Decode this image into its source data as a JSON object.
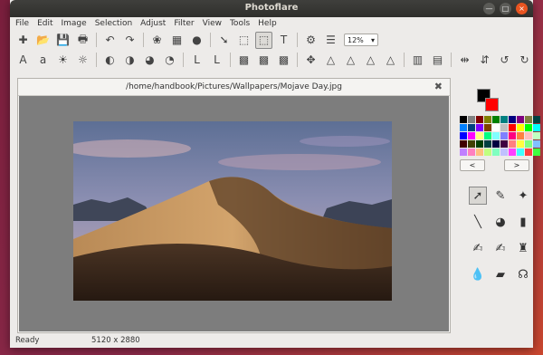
{
  "window": {
    "title": "Photoflare",
    "min": "—",
    "max": "□",
    "close": "×"
  },
  "menu": [
    "File",
    "Edit",
    "Image",
    "Selection",
    "Adjust",
    "Filter",
    "View",
    "Tools",
    "Help"
  ],
  "toolbar1": [
    {
      "name": "new-file-icon",
      "glyph": "✚"
    },
    {
      "name": "open-folder-icon",
      "glyph": "📂"
    },
    {
      "name": "save-icon",
      "glyph": "💾"
    },
    {
      "name": "print-icon",
      "glyph": "🖶"
    },
    {
      "name": "undo-icon",
      "glyph": "↶"
    },
    {
      "name": "redo-icon",
      "glyph": "↷"
    },
    {
      "name": "color-palette-icon",
      "glyph": "❀"
    },
    {
      "name": "mosaic-icon",
      "glyph": "▦"
    },
    {
      "name": "color-balls-icon",
      "glyph": "●"
    },
    {
      "name": "pointer-icon",
      "glyph": "➘"
    },
    {
      "name": "select-icon",
      "glyph": "⬚"
    },
    {
      "name": "select-active-icon",
      "glyph": "⬚"
    },
    {
      "name": "text-icon",
      "glyph": "T"
    },
    {
      "name": "settings-icon",
      "glyph": "⚙"
    },
    {
      "name": "layers-icon",
      "glyph": "☰"
    }
  ],
  "zoom": {
    "value": "12%",
    "arrow": "▾"
  },
  "toolbar2": [
    {
      "name": "text-size-icon",
      "glyph": "A"
    },
    {
      "name": "text-style-icon",
      "glyph": "a"
    },
    {
      "name": "brightness-up-icon",
      "glyph": "☀"
    },
    {
      "name": "brightness-down-icon",
      "glyph": "☼"
    },
    {
      "name": "contrast-icon",
      "glyph": "◐"
    },
    {
      "name": "contrast2-icon",
      "glyph": "◑"
    },
    {
      "name": "saturation-icon",
      "glyph": "◕"
    },
    {
      "name": "red-tone-icon",
      "glyph": "◔"
    },
    {
      "name": "edge-icon",
      "glyph": "L"
    },
    {
      "name": "edge2-icon",
      "glyph": "L"
    },
    {
      "name": "grayscale-icon",
      "glyph": "▩"
    },
    {
      "name": "photo-icon",
      "glyph": "▩"
    },
    {
      "name": "sepia-icon",
      "glyph": "▩"
    },
    {
      "name": "move-icon",
      "glyph": "✥"
    },
    {
      "name": "triangle-icon",
      "glyph": "△"
    },
    {
      "name": "triangle2-icon",
      "glyph": "△"
    },
    {
      "name": "triangle3-icon",
      "glyph": "△"
    },
    {
      "name": "triangle4-icon",
      "glyph": "△"
    },
    {
      "name": "rainbow-icon",
      "glyph": "▥"
    },
    {
      "name": "gradient-icon",
      "glyph": "▤"
    },
    {
      "name": "flip-horizontal-icon",
      "glyph": "⇹"
    },
    {
      "name": "flip-vertical-icon",
      "glyph": "⇵"
    },
    {
      "name": "rotate-left-icon",
      "glyph": "↺"
    },
    {
      "name": "rotate-right-icon",
      "glyph": "↻"
    }
  ],
  "document": {
    "path": "/home/handbook/Pictures/Wallpapers/Mojave Day.jpg",
    "close": "✖"
  },
  "status": {
    "left": "Ready",
    "size": "5120 x 2880"
  },
  "colors": {
    "foreground": "#000000",
    "background": "#ff0000"
  },
  "palette": [
    "#000000",
    "#808080",
    "#800000",
    "#808000",
    "#008000",
    "#008080",
    "#000080",
    "#800080",
    "#808040",
    "#004040",
    "#0080ff",
    "#004080",
    "#8000ff",
    "#804000",
    "#ffffff",
    "#c0c0c0",
    "#ff0000",
    "#ffff00",
    "#00ff00",
    "#00ffff",
    "#0000ff",
    "#ff00ff",
    "#ffff80",
    "#00ff80",
    "#80ffff",
    "#8080ff",
    "#ff0080",
    "#ff8040",
    "#ffc0c0",
    "#c0ffc0",
    "#400000",
    "#404000",
    "#004000",
    "#004040",
    "#000040",
    "#400040",
    "#ff8080",
    "#ffff40",
    "#80ff80",
    "#80c0ff",
    "#c080ff",
    "#ff80c0",
    "#ffc080",
    "#c0ff80",
    "#80ffc0",
    "#c0c0ff",
    "#ff40ff",
    "#40ffff",
    "#ff4040",
    "#40ff40"
  ],
  "palette_nav": {
    "prev": "<",
    "next": ">"
  },
  "tools": [
    {
      "name": "pointer-tool-icon",
      "glyph": "➚",
      "active": true
    },
    {
      "name": "eyedropper-icon",
      "glyph": "✎",
      "active": false
    },
    {
      "name": "magic-wand-icon",
      "glyph": "✦",
      "active": false
    },
    {
      "name": "line-tool-icon",
      "glyph": "╲",
      "active": false
    },
    {
      "name": "paint-bucket-icon",
      "glyph": "◕",
      "active": false
    },
    {
      "name": "spray-can-icon",
      "glyph": "▮",
      "active": false
    },
    {
      "name": "brush-icon",
      "glyph": "✍",
      "active": false
    },
    {
      "name": "smudge-brush-icon",
      "glyph": "✍",
      "active": false
    },
    {
      "name": "stamp-icon",
      "glyph": "♜",
      "active": false
    },
    {
      "name": "blur-drop-icon",
      "glyph": "💧",
      "active": false
    },
    {
      "name": "eraser-icon",
      "glyph": "▰",
      "active": false
    },
    {
      "name": "clone-icon",
      "glyph": "☊",
      "active": false
    }
  ]
}
